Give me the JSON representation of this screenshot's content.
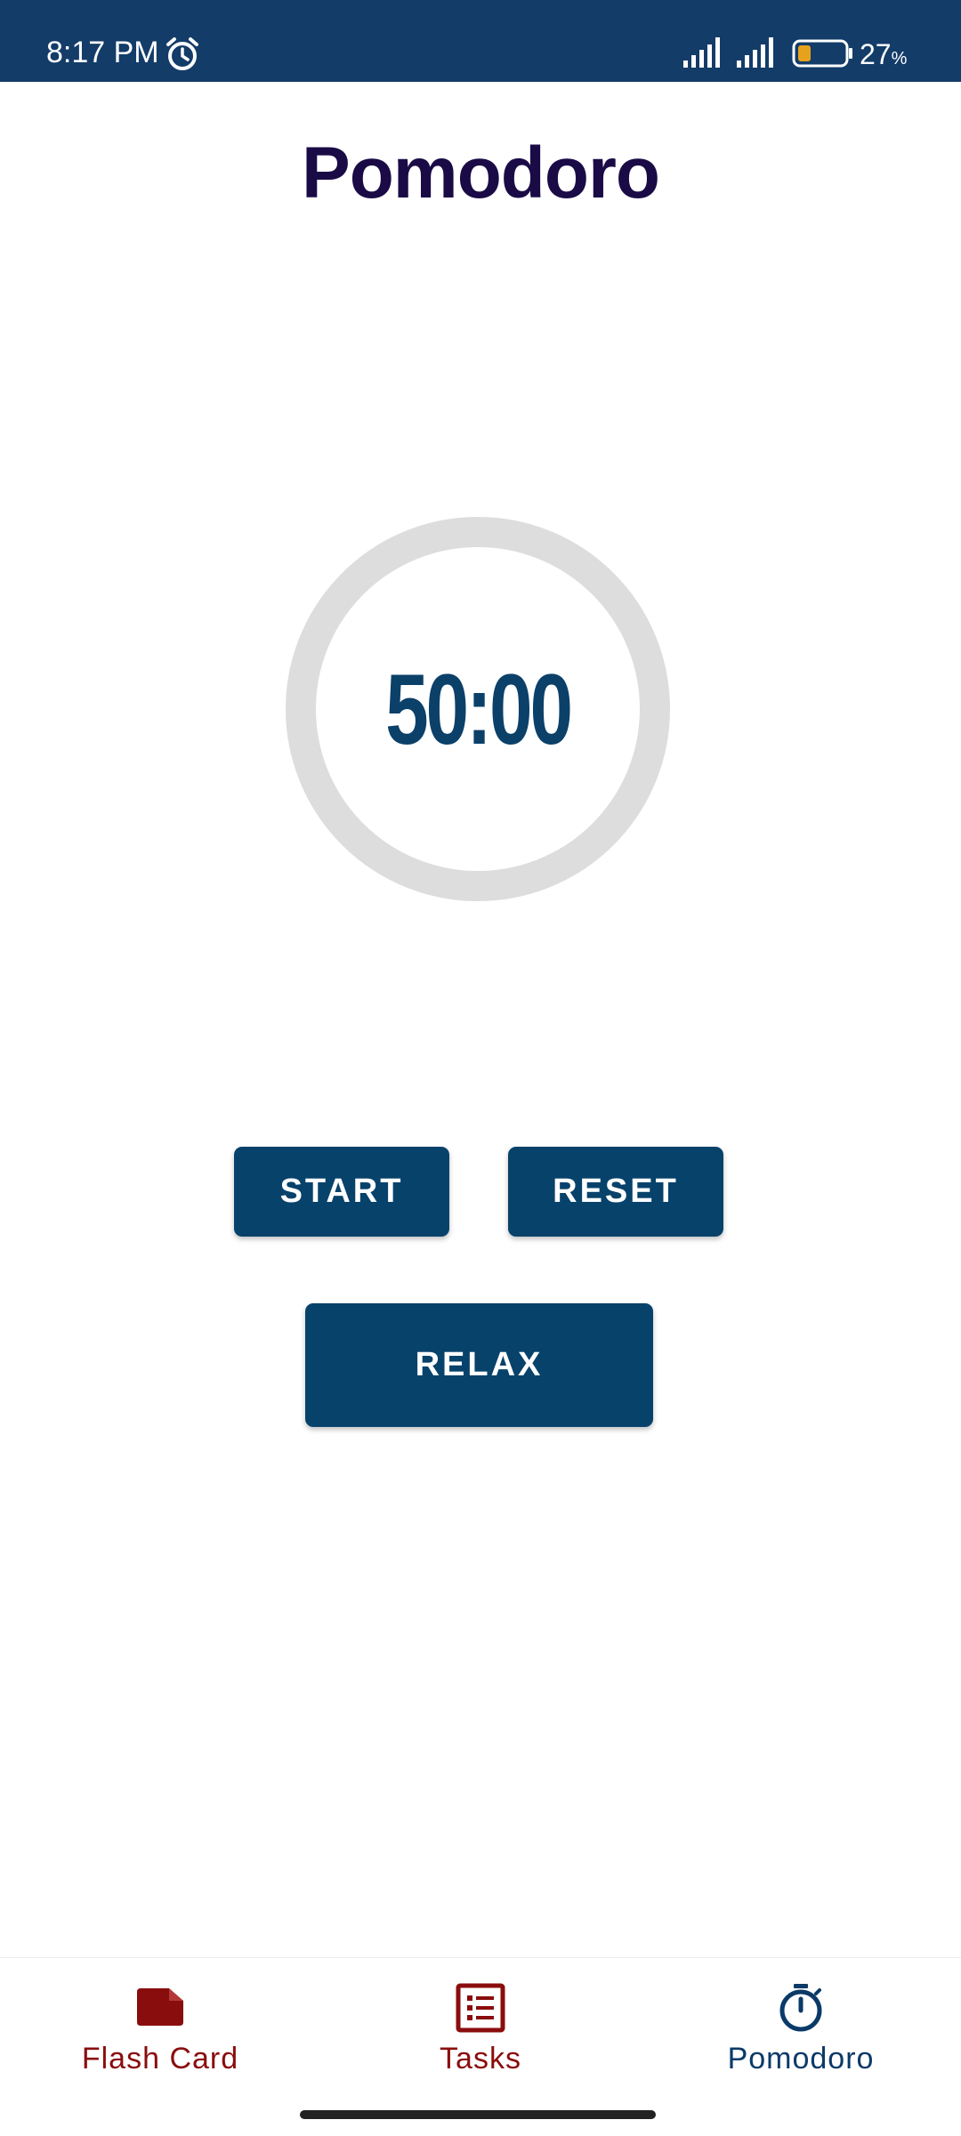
{
  "status_bar": {
    "time": "8:17 PM",
    "battery_number": "27",
    "battery_unit": "%",
    "icons": [
      "alarm-icon",
      "signal-icon",
      "signal-icon",
      "battery-icon"
    ]
  },
  "title": "Pomodoro",
  "timer": {
    "display": "50:00",
    "progress": 0
  },
  "buttons": {
    "start": "START",
    "reset": "RESET",
    "relax": "RELAX"
  },
  "nav": {
    "items": [
      {
        "label": "Flash Card",
        "icon": "flash-card-icon"
      },
      {
        "label": "Tasks",
        "icon": "tasks-icon"
      },
      {
        "label": "Pomodoro",
        "icon": "stopwatch-icon"
      }
    ],
    "active": "Pomodoro"
  },
  "colors": {
    "status_bar": "#133c69",
    "primary": "#07426b",
    "title": "#1a0b46",
    "timer_text": "#0b4069",
    "ring": "#dddddd",
    "nav_inactive": "#8a0d0d",
    "nav_active": "#0b3a68"
  }
}
